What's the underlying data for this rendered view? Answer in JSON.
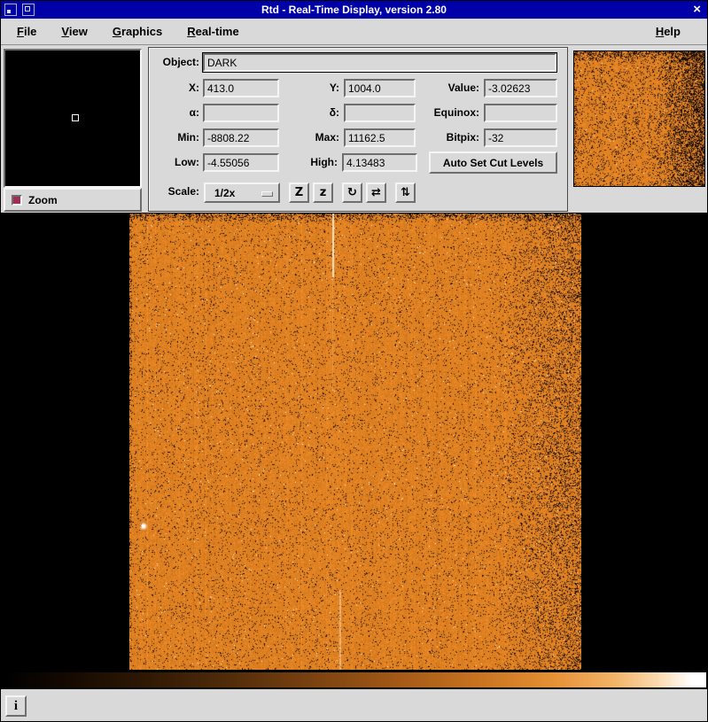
{
  "window": {
    "title": "Rtd - Real-Time Display, version 2.80",
    "close_glyph": "×"
  },
  "menubar": {
    "items": [
      "File",
      "View",
      "Graphics",
      "Real-time"
    ],
    "help": "Help"
  },
  "controls": {
    "zoom_label": "Zoom",
    "fields": {
      "object": {
        "label": "Object:",
        "value": "DARK"
      },
      "x": {
        "label": "X:",
        "value": "413.0"
      },
      "y": {
        "label": "Y:",
        "value": "1004.0"
      },
      "value": {
        "label": "Value:",
        "value": "-3.02623"
      },
      "alpha": {
        "label": "α:",
        "value": ""
      },
      "delta": {
        "label": "δ:",
        "value": ""
      },
      "equinox": {
        "label": "Equinox:",
        "value": ""
      },
      "min": {
        "label": "Min:",
        "value": "-8808.22"
      },
      "max": {
        "label": "Max:",
        "value": "11162.5"
      },
      "bitpix": {
        "label": "Bitpix:",
        "value": "-32"
      },
      "low": {
        "label": "Low:",
        "value": "-4.55056"
      },
      "high": {
        "label": "High:",
        "value": "4.13483"
      }
    },
    "auto_cut_label": "Auto Set Cut Levels",
    "scale": {
      "label": "Scale:",
      "value": "1/2x"
    },
    "tools": {
      "zoom_in": "Z",
      "zoom_out": "z",
      "rotate": "↻",
      "flip_x": "⇄",
      "flip_y": "⇅"
    }
  },
  "statusbar": {
    "info_glyph": "i"
  },
  "colors": {
    "titlebar": "#0000a8",
    "panel": "#d9d9d9",
    "checkbox_on": "#9e2f50"
  },
  "image": {
    "base_rgb": [
      223,
      129,
      34
    ],
    "colorbar_stops": [
      "#000000 0%",
      "#120800 8%",
      "#2e1804 20%",
      "#512c0a 32%",
      "#7a4210 44%",
      "#a35916 56%",
      "#c97420 68%",
      "#e69034 78%",
      "#f3b468 87%",
      "#fbd9ae 93%",
      "#ffffff 98%"
    ]
  }
}
